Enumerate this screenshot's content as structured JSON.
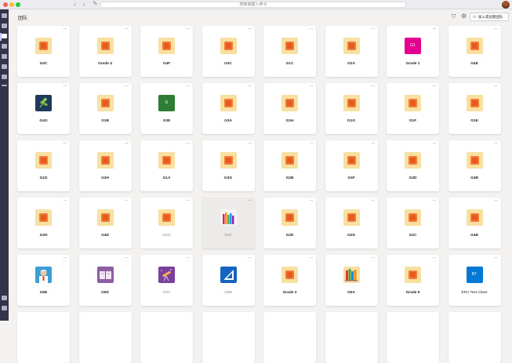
{
  "titlebar": {
    "search_placeholder": "搜索或键入命令"
  },
  "header": {
    "title": "团队",
    "join_label": "加入或创建团队"
  },
  "icons": {
    "back": "chevron-left-icon",
    "forward": "chevron-right-icon",
    "compose": "compose-icon",
    "filter": "filter-icon",
    "settings": "settings-icon",
    "more": "more-options-icon",
    "avatar": "user-avatar"
  },
  "colors": {
    "rail": "#33344a",
    "tile_default_bg": "#f9e0a0",
    "tile_default_fg": "#e85a1b",
    "g1": "#e3008c",
    "g3e": "#2e7d32",
    "test_class": "#0078d4"
  },
  "teams": [
    [
      {
        "label": "G4C",
        "icon": "default"
      },
      {
        "label": "Grade 4",
        "icon": "default"
      },
      {
        "label": "G4F",
        "icon": "default"
      },
      {
        "label": "G3C",
        "icon": "default"
      },
      {
        "label": "G1C",
        "icon": "default"
      },
      {
        "label": "G2A",
        "icon": "default"
      },
      {
        "label": "Grade 1",
        "icon": "letter",
        "tile_text": "G1",
        "color": "#e3008c"
      },
      {
        "label": "G4E",
        "icon": "default"
      }
    ],
    [
      {
        "label": "G4G",
        "icon": "plant"
      },
      {
        "label": "G1B",
        "icon": "default"
      },
      {
        "label": "G3E",
        "icon": "letter",
        "tile_text": "G",
        "color": "#2e7d32"
      },
      {
        "label": "G3A",
        "icon": "default"
      },
      {
        "label": "G1H",
        "icon": "default"
      },
      {
        "label": "G1G",
        "icon": "default"
      },
      {
        "label": "G1F",
        "icon": "default"
      },
      {
        "label": "G1E",
        "icon": "default"
      }
    ],
    [
      {
        "label": "G1D",
        "icon": "default"
      },
      {
        "label": "G3H",
        "icon": "default"
      },
      {
        "label": "G1A",
        "icon": "default"
      },
      {
        "label": "G3G",
        "icon": "default"
      },
      {
        "label": "G2B",
        "icon": "default"
      },
      {
        "label": "G3F",
        "icon": "default"
      },
      {
        "label": "G3D",
        "icon": "default"
      },
      {
        "label": "G3B",
        "icon": "default"
      }
    ],
    [
      {
        "label": "G2H",
        "icon": "default"
      },
      {
        "label": "G4D",
        "icon": "default"
      },
      {
        "label": "G2G",
        "icon": "default",
        "style": "light"
      },
      {
        "label": "G2F",
        "icon": "pencils",
        "style": "light",
        "hover": true
      },
      {
        "label": "G2E",
        "icon": "default"
      },
      {
        "label": "G2D",
        "icon": "default"
      },
      {
        "label": "G2C",
        "icon": "default"
      },
      {
        "label": "G4B",
        "icon": "default"
      }
    ],
    [
      {
        "label": "G5E",
        "icon": "teacher"
      },
      {
        "label": "G5D",
        "icon": "book"
      },
      {
        "label": "G5C",
        "icon": "telescope",
        "style": "light"
      },
      {
        "label": "G5B",
        "icon": "ruler",
        "style": "light"
      },
      {
        "label": "Grade 3",
        "icon": "default"
      },
      {
        "label": "G5A",
        "icon": "library"
      },
      {
        "label": "Grade 5",
        "icon": "default"
      },
      {
        "label": "ERA Test Class",
        "icon": "letter",
        "tile_text": "BT",
        "color": "#0078d4",
        "style": "dark-normal"
      }
    ]
  ]
}
